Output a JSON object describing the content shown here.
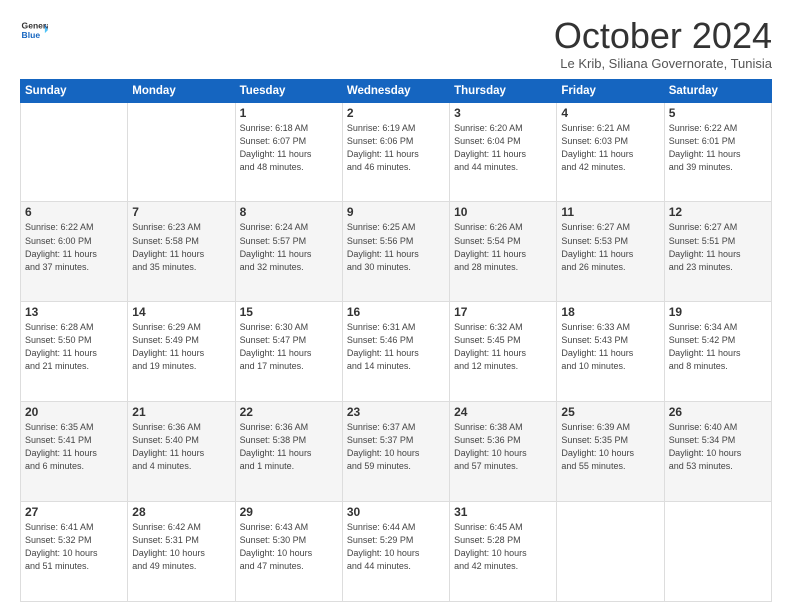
{
  "logo": {
    "line1": "General",
    "line2": "Blue"
  },
  "title": "October 2024",
  "subtitle": "Le Krib, Siliana Governorate, Tunisia",
  "days_of_week": [
    "Sunday",
    "Monday",
    "Tuesday",
    "Wednesday",
    "Thursday",
    "Friday",
    "Saturday"
  ],
  "weeks": [
    [
      {
        "day": "",
        "info": ""
      },
      {
        "day": "",
        "info": ""
      },
      {
        "day": "1",
        "info": "Sunrise: 6:18 AM\nSunset: 6:07 PM\nDaylight: 11 hours\nand 48 minutes."
      },
      {
        "day": "2",
        "info": "Sunrise: 6:19 AM\nSunset: 6:06 PM\nDaylight: 11 hours\nand 46 minutes."
      },
      {
        "day": "3",
        "info": "Sunrise: 6:20 AM\nSunset: 6:04 PM\nDaylight: 11 hours\nand 44 minutes."
      },
      {
        "day": "4",
        "info": "Sunrise: 6:21 AM\nSunset: 6:03 PM\nDaylight: 11 hours\nand 42 minutes."
      },
      {
        "day": "5",
        "info": "Sunrise: 6:22 AM\nSunset: 6:01 PM\nDaylight: 11 hours\nand 39 minutes."
      }
    ],
    [
      {
        "day": "6",
        "info": "Sunrise: 6:22 AM\nSunset: 6:00 PM\nDaylight: 11 hours\nand 37 minutes."
      },
      {
        "day": "7",
        "info": "Sunrise: 6:23 AM\nSunset: 5:58 PM\nDaylight: 11 hours\nand 35 minutes."
      },
      {
        "day": "8",
        "info": "Sunrise: 6:24 AM\nSunset: 5:57 PM\nDaylight: 11 hours\nand 32 minutes."
      },
      {
        "day": "9",
        "info": "Sunrise: 6:25 AM\nSunset: 5:56 PM\nDaylight: 11 hours\nand 30 minutes."
      },
      {
        "day": "10",
        "info": "Sunrise: 6:26 AM\nSunset: 5:54 PM\nDaylight: 11 hours\nand 28 minutes."
      },
      {
        "day": "11",
        "info": "Sunrise: 6:27 AM\nSunset: 5:53 PM\nDaylight: 11 hours\nand 26 minutes."
      },
      {
        "day": "12",
        "info": "Sunrise: 6:27 AM\nSunset: 5:51 PM\nDaylight: 11 hours\nand 23 minutes."
      }
    ],
    [
      {
        "day": "13",
        "info": "Sunrise: 6:28 AM\nSunset: 5:50 PM\nDaylight: 11 hours\nand 21 minutes."
      },
      {
        "day": "14",
        "info": "Sunrise: 6:29 AM\nSunset: 5:49 PM\nDaylight: 11 hours\nand 19 minutes."
      },
      {
        "day": "15",
        "info": "Sunrise: 6:30 AM\nSunset: 5:47 PM\nDaylight: 11 hours\nand 17 minutes."
      },
      {
        "day": "16",
        "info": "Sunrise: 6:31 AM\nSunset: 5:46 PM\nDaylight: 11 hours\nand 14 minutes."
      },
      {
        "day": "17",
        "info": "Sunrise: 6:32 AM\nSunset: 5:45 PM\nDaylight: 11 hours\nand 12 minutes."
      },
      {
        "day": "18",
        "info": "Sunrise: 6:33 AM\nSunset: 5:43 PM\nDaylight: 11 hours\nand 10 minutes."
      },
      {
        "day": "19",
        "info": "Sunrise: 6:34 AM\nSunset: 5:42 PM\nDaylight: 11 hours\nand 8 minutes."
      }
    ],
    [
      {
        "day": "20",
        "info": "Sunrise: 6:35 AM\nSunset: 5:41 PM\nDaylight: 11 hours\nand 6 minutes."
      },
      {
        "day": "21",
        "info": "Sunrise: 6:36 AM\nSunset: 5:40 PM\nDaylight: 11 hours\nand 4 minutes."
      },
      {
        "day": "22",
        "info": "Sunrise: 6:36 AM\nSunset: 5:38 PM\nDaylight: 11 hours\nand 1 minute."
      },
      {
        "day": "23",
        "info": "Sunrise: 6:37 AM\nSunset: 5:37 PM\nDaylight: 10 hours\nand 59 minutes."
      },
      {
        "day": "24",
        "info": "Sunrise: 6:38 AM\nSunset: 5:36 PM\nDaylight: 10 hours\nand 57 minutes."
      },
      {
        "day": "25",
        "info": "Sunrise: 6:39 AM\nSunset: 5:35 PM\nDaylight: 10 hours\nand 55 minutes."
      },
      {
        "day": "26",
        "info": "Sunrise: 6:40 AM\nSunset: 5:34 PM\nDaylight: 10 hours\nand 53 minutes."
      }
    ],
    [
      {
        "day": "27",
        "info": "Sunrise: 6:41 AM\nSunset: 5:32 PM\nDaylight: 10 hours\nand 51 minutes."
      },
      {
        "day": "28",
        "info": "Sunrise: 6:42 AM\nSunset: 5:31 PM\nDaylight: 10 hours\nand 49 minutes."
      },
      {
        "day": "29",
        "info": "Sunrise: 6:43 AM\nSunset: 5:30 PM\nDaylight: 10 hours\nand 47 minutes."
      },
      {
        "day": "30",
        "info": "Sunrise: 6:44 AM\nSunset: 5:29 PM\nDaylight: 10 hours\nand 44 minutes."
      },
      {
        "day": "31",
        "info": "Sunrise: 6:45 AM\nSunset: 5:28 PM\nDaylight: 10 hours\nand 42 minutes."
      },
      {
        "day": "",
        "info": ""
      },
      {
        "day": "",
        "info": ""
      }
    ]
  ]
}
